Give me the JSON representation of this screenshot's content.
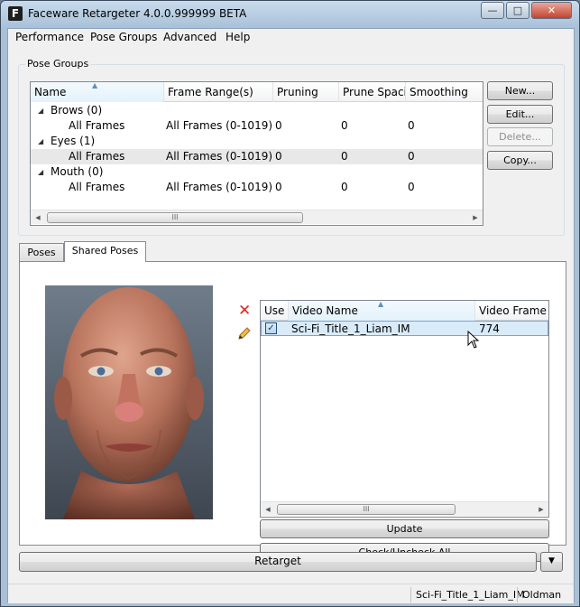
{
  "window": {
    "title": "Faceware Retargeter 4.0.0.999999 BETA",
    "app_icon": "F",
    "minimize": "—",
    "maximize": "□",
    "close": "✕"
  },
  "menu": {
    "performance": "Performance",
    "pose_groups": "Pose Groups",
    "advanced": "Advanced",
    "help": "Help"
  },
  "pose_groups": {
    "label": "Pose Groups",
    "columns": [
      "Name",
      "Frame Range(s)",
      "Pruning",
      "Prune Spacing",
      "Smoothing"
    ],
    "rows": [
      {
        "kind": "group",
        "name": "Brows (0)",
        "frame_range": "",
        "pruning": "",
        "prune_spacing": "",
        "smoothing": ""
      },
      {
        "kind": "item",
        "name": "All Frames",
        "frame_range": "All Frames (0-1019)",
        "pruning": "0",
        "prune_spacing": "0",
        "smoothing": "0",
        "selected": false
      },
      {
        "kind": "group",
        "name": "Eyes (1)",
        "frame_range": "",
        "pruning": "",
        "prune_spacing": "",
        "smoothing": ""
      },
      {
        "kind": "item",
        "name": "All Frames",
        "frame_range": "All Frames (0-1019)",
        "pruning": "0",
        "prune_spacing": "0",
        "smoothing": "0",
        "selected": true
      },
      {
        "kind": "group",
        "name": "Mouth (0)",
        "frame_range": "",
        "pruning": "",
        "prune_spacing": "",
        "smoothing": ""
      },
      {
        "kind": "item",
        "name": "All Frames",
        "frame_range": "All Frames (0-1019)",
        "pruning": "0",
        "prune_spacing": "0",
        "smoothing": "0",
        "selected": false
      }
    ],
    "buttons": {
      "new": "New...",
      "edit": "Edit...",
      "delete": "Delete...",
      "copy": "Copy..."
    },
    "scroll_thumb": "III"
  },
  "tabs": {
    "poses": "Poses",
    "shared_poses": "Shared Poses",
    "active": "shared_poses"
  },
  "shared_poses": {
    "columns": [
      "Use",
      "Video Name",
      "Video Frame"
    ],
    "rows": [
      {
        "use": true,
        "video_name": "Sci-Fi_Title_1_Liam_IM",
        "video_frame": "774"
      }
    ],
    "check_glyph": "✓",
    "scroll_thumb": "III",
    "buttons": {
      "update": "Update",
      "check_uncheck_all": "Check/Uncheck All"
    },
    "icons": {
      "delete": "delete-icon",
      "edit": "pencil-icon"
    }
  },
  "retarget": {
    "label": "Retarget",
    "dropdown_glyph": "▼"
  },
  "status": {
    "video": "Sci-Fi_Title_1_Liam_IM",
    "character": "Oldman"
  }
}
